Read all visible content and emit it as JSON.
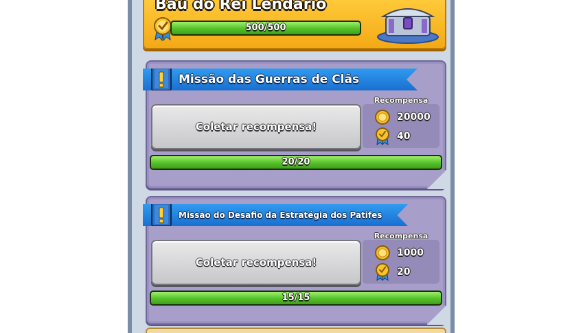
{
  "chest": {
    "title": "Baú do Rei Lendário",
    "progress_text": "500/500",
    "progress_fraction": 1.0
  },
  "missions": [
    {
      "title": "Missão das Guerras de Clãs",
      "collect_label": "Coletar recompensa!",
      "reward_title": "Recompensa",
      "gold": "20000",
      "crowns": "40",
      "progress_text": "20/20",
      "progress_fraction": 1.0
    },
    {
      "title": "Missão do Desafio da Estratégia dos Patifes",
      "collect_label": "Coletar recompensa!",
      "reward_title": "Recompensa",
      "gold": "1000",
      "crowns": "20",
      "progress_text": "15/15",
      "progress_fraction": 1.0
    }
  ],
  "icons": {
    "gold": "gold-coin-icon",
    "crown": "crown-medal-icon",
    "mission": "exclamation-book-icon",
    "chest": "legendary-king-chest-icon"
  },
  "colors": {
    "chest_gold": "#f4a916",
    "mission_bg": "#a79fca",
    "banner_blue": "#1a6fd0",
    "progress_green": "#55c028"
  }
}
